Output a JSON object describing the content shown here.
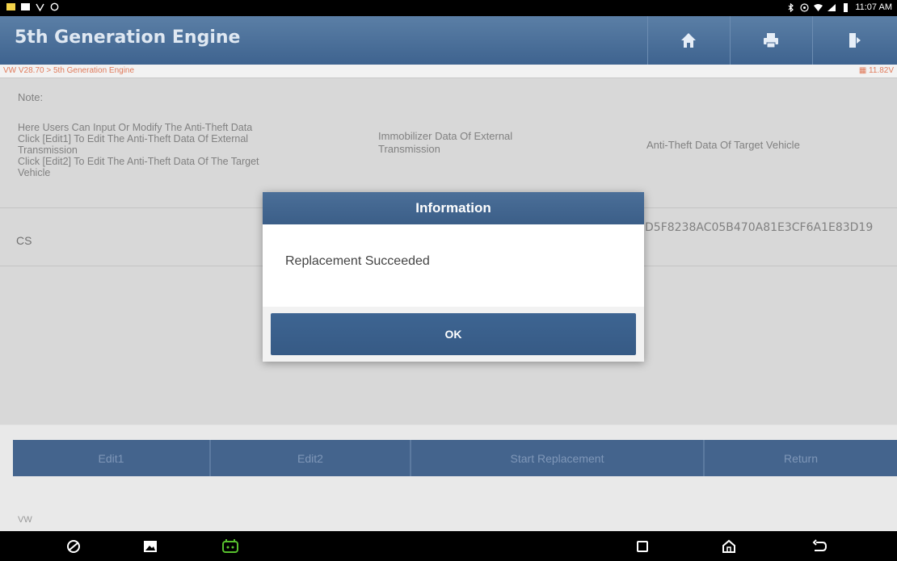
{
  "status_bar": {
    "time": "11:07 AM",
    "left_icons": [
      "notification-icon",
      "message-icon",
      "vpn-icon",
      "sync-icon"
    ],
    "right_icons": [
      "bluetooth-icon",
      "nfc-icon",
      "wifi-icon",
      "signal-icon",
      "battery-icon"
    ]
  },
  "header": {
    "title": "5th Generation Engine",
    "icons": [
      "home-icon",
      "print-icon",
      "exit-icon"
    ]
  },
  "breadcrumb": {
    "path": "VW V28.70 > 5th Generation Engine",
    "voltage": "11.82V"
  },
  "main": {
    "note_label": "Note:",
    "note_lines": [
      "Here Users Can Input Or Modify The Anti-Theft Data",
      "Click [Edit1] To Edit The Anti-Theft Data Of External",
      "Transmission",
      "Click [Edit2] To Edit The Anti-Theft Data Of The Target",
      "Vehicle"
    ],
    "col1_header": "Immobilizer Data Of External Transmission",
    "col2_header": "Anti-Theft Data Of Target Vehicle",
    "row": {
      "label": "CS",
      "value": "D5F8238AC05B470A81E3CF6A1E83D19"
    }
  },
  "buttons": {
    "edit1": "Edit1",
    "edit2": "Edit2",
    "start_replacement": "Start Replacement",
    "return": "Return"
  },
  "footer": {
    "brand": "VW"
  },
  "nav_bar": {
    "icons": [
      "browser-icon",
      "gallery-icon",
      "vci-icon",
      "recents-icon",
      "home-nav-icon",
      "back-icon"
    ]
  },
  "dialog": {
    "title": "Information",
    "message": "Replacement Succeeded",
    "ok_label": "OK"
  },
  "colors": {
    "header_blue": "#3e638f",
    "button_blue": "#44648d",
    "accent_orange": "#e07a5a",
    "vci_green": "#58c22e"
  }
}
